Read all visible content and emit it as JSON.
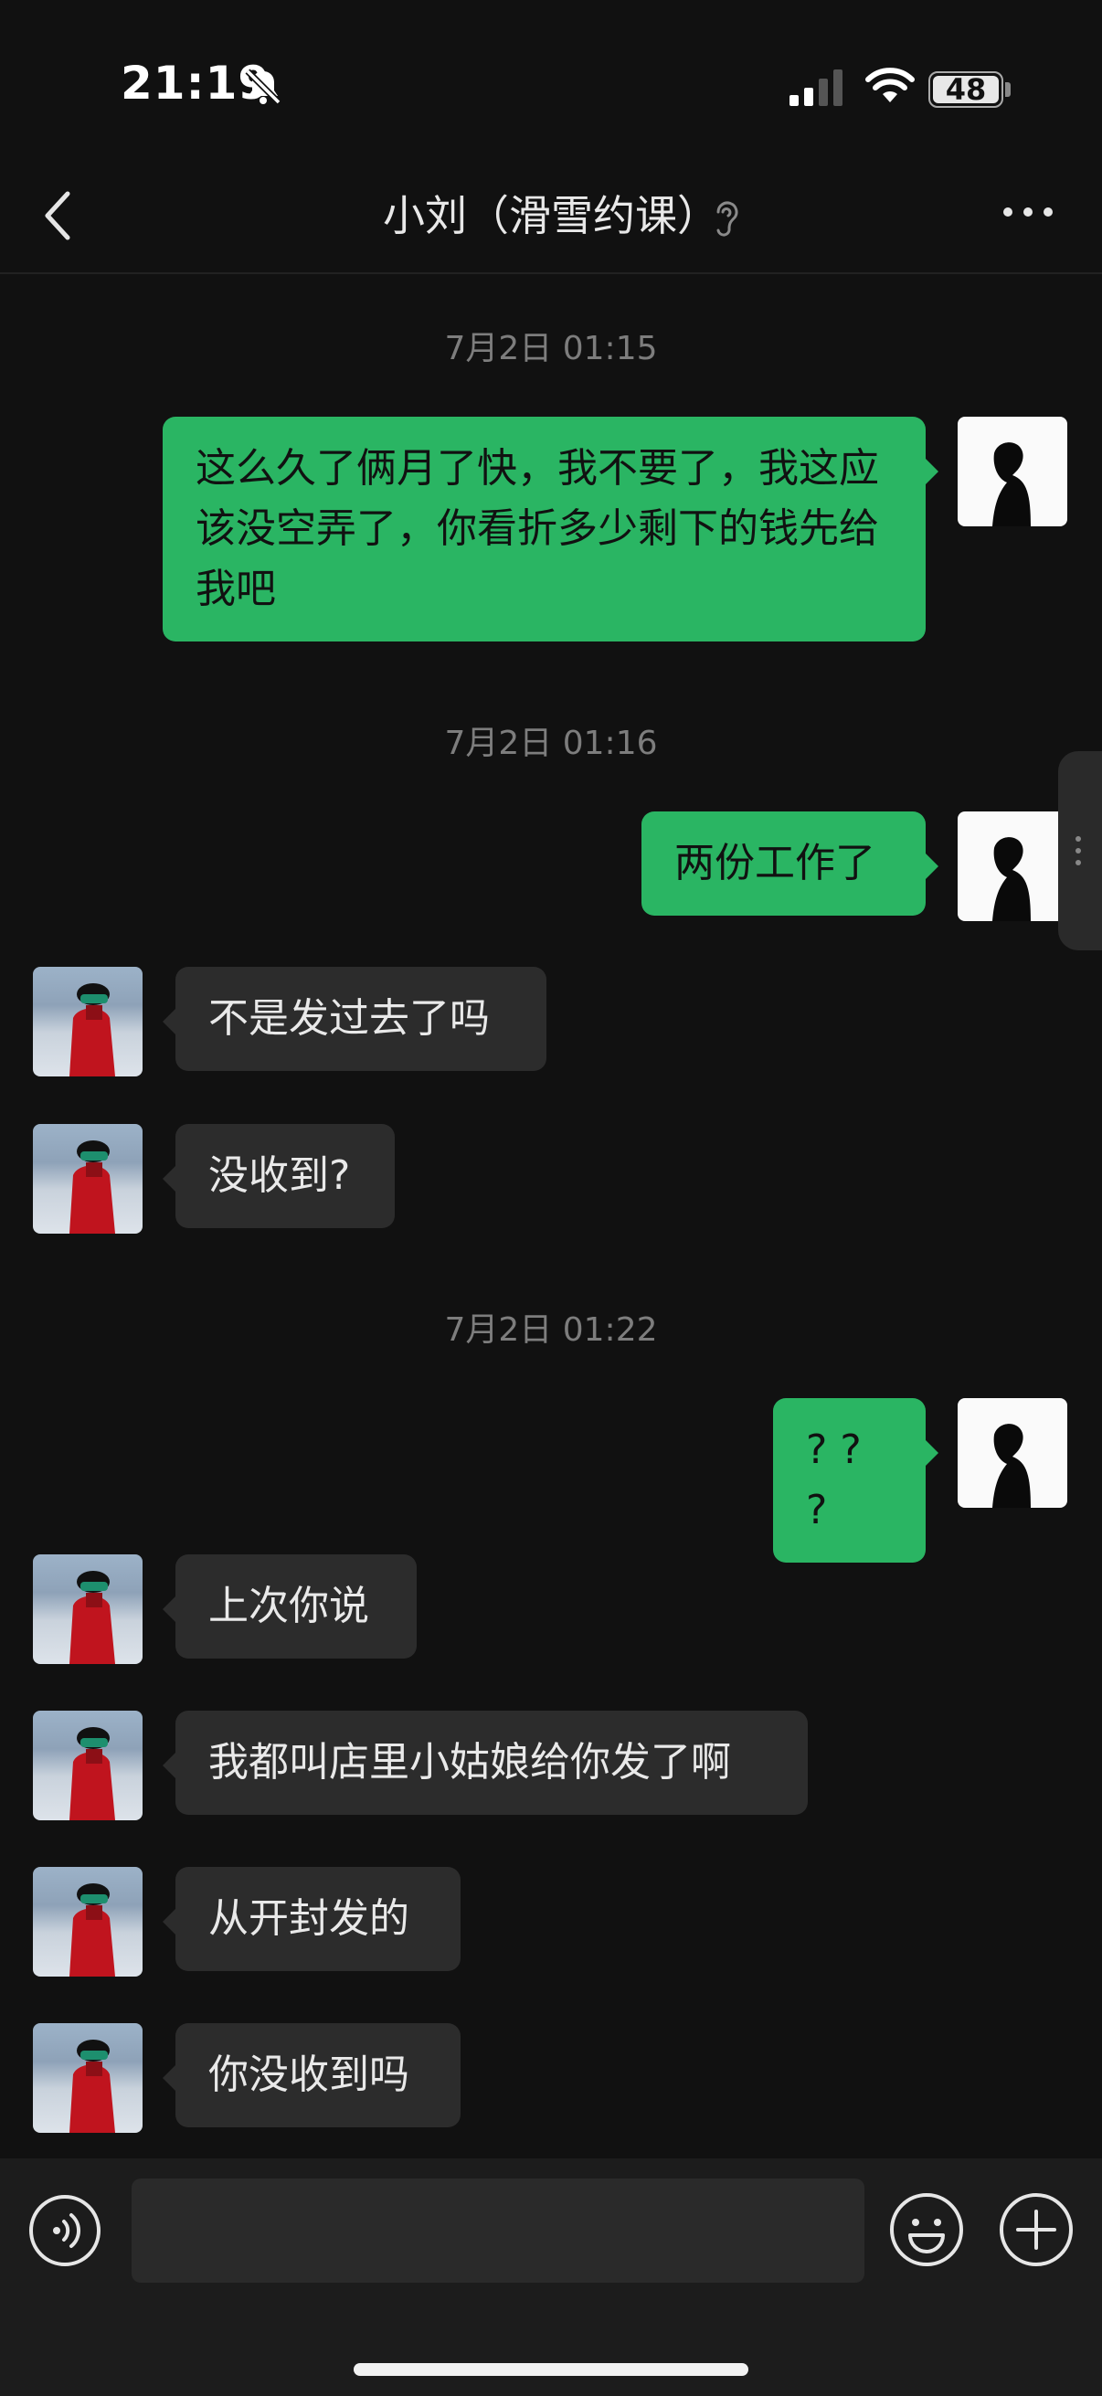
{
  "status_bar": {
    "time": "21:19",
    "battery": "48"
  },
  "nav": {
    "title": "小刘（滑雪约课）"
  },
  "input": {
    "placeholder": ""
  },
  "messages": [
    {
      "type": "time",
      "text": "7月2日 01:15"
    },
    {
      "type": "self",
      "text": "这么久了俩月了快，我不要了，我这应该没空弄了，你看折多少剩下的钱先给我吧"
    },
    {
      "type": "time",
      "text": "7月2日 01:16"
    },
    {
      "type": "self",
      "text": "两份工作了"
    },
    {
      "type": "other",
      "text": "不是发过去了吗"
    },
    {
      "type": "other",
      "text": "没收到?"
    },
    {
      "type": "time",
      "text": "7月2日 01:22"
    },
    {
      "type": "self",
      "text": "? ? ?"
    },
    {
      "type": "other",
      "text": "上次你说"
    },
    {
      "type": "other",
      "text": "我都叫店里小姑娘给你发了啊"
    },
    {
      "type": "other",
      "text": "从开封发的"
    },
    {
      "type": "other",
      "text": "你没收到吗"
    }
  ],
  "icons": {
    "bell": "bell-slash-icon",
    "back": "chevron-left-icon",
    "ear": "ear-icon",
    "more": "more-dots-icon",
    "voice": "voice-icon",
    "emoji": "emoji-icon",
    "plus": "plus-icon"
  },
  "colors": {
    "self_bubble": "#2ab563",
    "other_bubble": "#2c2c2c",
    "background": "#111111"
  }
}
